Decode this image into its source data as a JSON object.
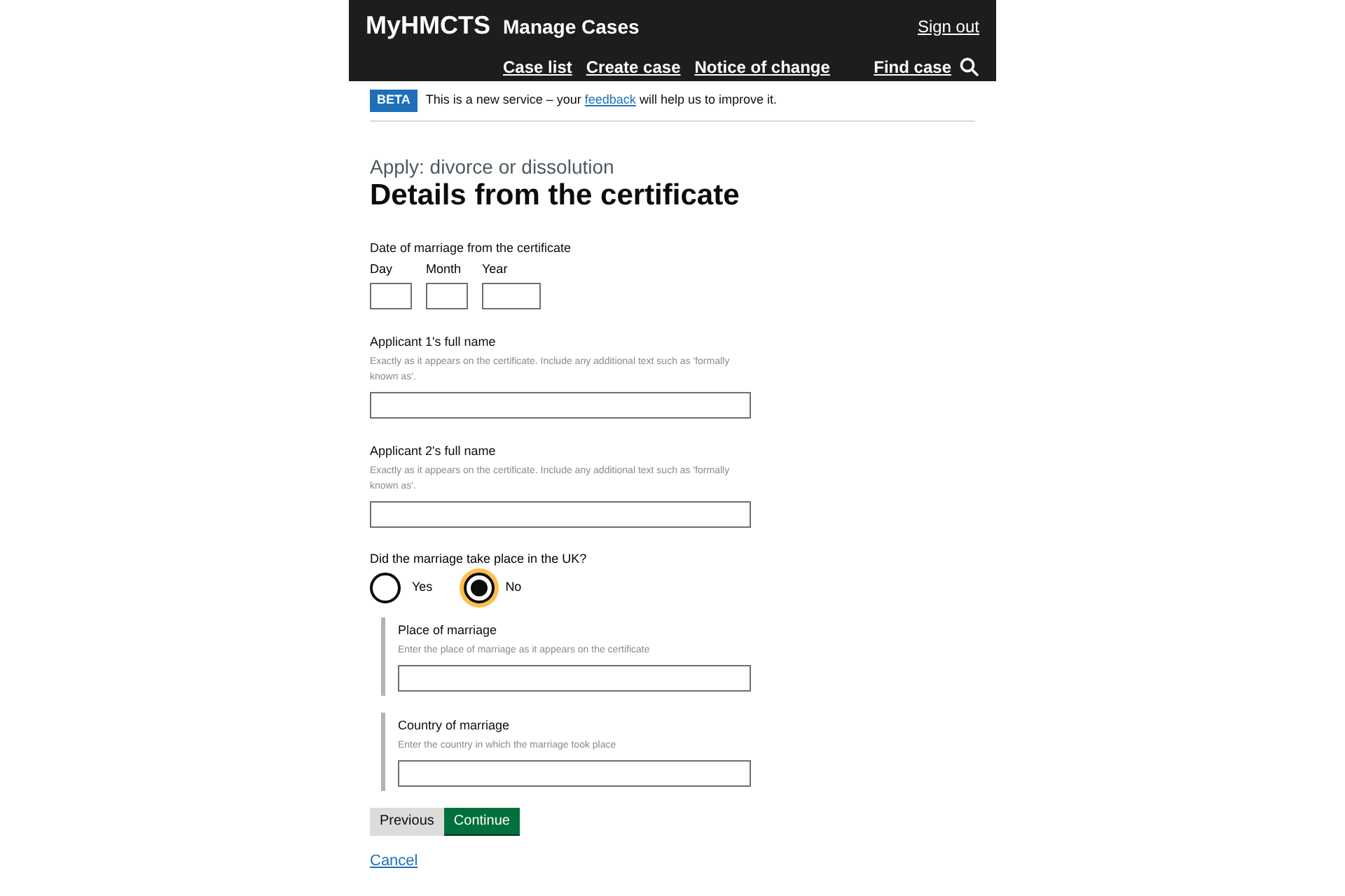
{
  "header": {
    "logo": "MyHMCTS",
    "service": "Manage Cases",
    "sign_out": "Sign out",
    "nav": [
      "Case list",
      "Create case",
      "Notice of change"
    ],
    "find_case": "Find case"
  },
  "beta": {
    "tag": "BETA",
    "before": "This is a new service – your",
    "link": "feedback",
    "after": "will help us to improve it."
  },
  "caption": "Apply: divorce or dissolution",
  "title": "Details from the certificate",
  "date": {
    "label": "Date of marriage from the certificate",
    "parts": [
      {
        "label": "Day",
        "kind": "short"
      },
      {
        "label": "Month",
        "kind": "short"
      },
      {
        "label": "Year",
        "kind": "long"
      }
    ]
  },
  "names": [
    {
      "label": "Applicant 1's full name",
      "hint": "Exactly as it appears on the certificate. Include any additional text such as 'formally known as'."
    },
    {
      "label": "Applicant 2's full name",
      "hint": "Exactly as it appears on the certificate. Include any additional text such as 'formally known as'."
    }
  ],
  "question": {
    "label": "Did the marriage take place in the UK?",
    "options": [
      {
        "label": "Yes",
        "selected": false
      },
      {
        "label": "No",
        "selected": true
      }
    ]
  },
  "conditional": [
    {
      "label": "Place of marriage",
      "hint": "Enter the place of marriage as it appears on the certificate"
    },
    {
      "label": "Country of marriage",
      "hint": "Enter the country in which the marriage took place"
    }
  ],
  "buttons": {
    "previous": "Previous",
    "continue": "Continue"
  },
  "cancel": "Cancel"
}
